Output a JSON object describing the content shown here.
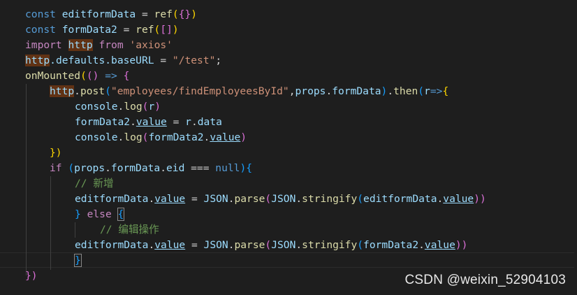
{
  "code": {
    "l1": [
      "const",
      " ",
      "editformData",
      " = ",
      "ref",
      "(",
      "{}",
      ")"
    ],
    "l2": [
      "const",
      " ",
      "formData2",
      " = ",
      "ref",
      "(",
      "[]",
      ")"
    ],
    "l3": [
      "import",
      " ",
      "http",
      " ",
      "from",
      " ",
      "'axios'"
    ],
    "l4": [
      "http",
      ".defaults.",
      "baseURL",
      " = ",
      "\"/test\"",
      ";"
    ],
    "l5": [
      "onMounted",
      "(",
      "()",
      " => ",
      "{"
    ],
    "l6": [
      "http",
      ".",
      "post",
      "(",
      "\"employees/findEmployeesById\"",
      ",",
      "props",
      ".",
      "formData",
      ")",
      ".",
      "then",
      "(",
      "r",
      "=>",
      "{"
    ],
    "l7": [
      "console",
      ".",
      "log",
      "(",
      "r",
      ")"
    ],
    "l8": [
      "formData2",
      ".",
      "value",
      " = ",
      "r",
      ".",
      "data"
    ],
    "l9": [
      "console",
      ".",
      "log",
      "(",
      "formData2",
      ".",
      "value",
      ")"
    ],
    "l10": [
      "})"
    ],
    "l11": [
      "if",
      " ",
      "(",
      "props",
      ".",
      "formData",
      ".",
      "eid",
      " === ",
      "null",
      ")",
      "{"
    ],
    "l12": [
      "// 新增"
    ],
    "l13": [
      "editformData",
      ".",
      "value",
      " = ",
      "JSON",
      ".",
      "parse",
      "(",
      "JSON",
      ".",
      "stringify",
      "(",
      "editformData",
      ".",
      "value",
      "))"
    ],
    "l14": [
      "}",
      " ",
      "else",
      " ",
      "{"
    ],
    "l15": [
      "// 编辑操作"
    ],
    "l16": [
      "editformData",
      ".",
      "value",
      " = ",
      "JSON",
      ".",
      "parse",
      "(",
      "JSON",
      ".",
      "stringify",
      "(",
      "formData2",
      ".",
      "value",
      "))"
    ],
    "l17": [
      "}"
    ],
    "l18": [
      "})"
    ]
  },
  "watermark": "CSDN @weixin_52904103",
  "colors": {
    "background": "#1e1e1e",
    "keyword": "#569cd6",
    "control": "#c586c0",
    "variable": "#9cdcfe",
    "function": "#dcdcaa",
    "string": "#ce9178",
    "comment": "#6a9955"
  }
}
